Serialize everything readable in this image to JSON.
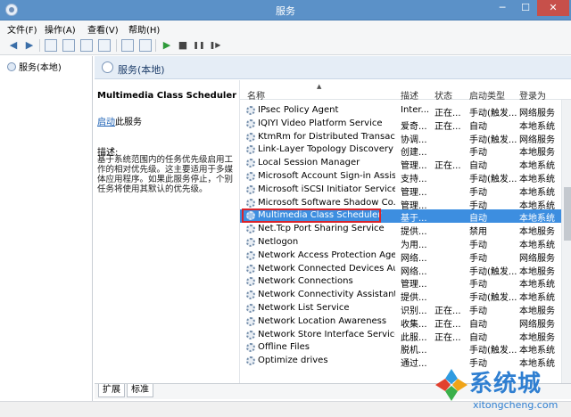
{
  "window": {
    "title": "服务",
    "minimize": "─",
    "maximize": "☐",
    "close": "✕"
  },
  "menu": [
    "文件(F)",
    "操作(A)",
    "查看(V)",
    "帮助(H)"
  ],
  "toolbar": {
    "back": "◀",
    "forward": "▶",
    "play": "▶",
    "stop": "■",
    "pause": "❚❚",
    "restart": "❚▶"
  },
  "tree": {
    "item": "服务(本地)"
  },
  "header": {
    "title": "服务(本地)"
  },
  "detail": {
    "name": "Multimedia Class Scheduler",
    "start_link": "启动",
    "start_suffix": "此服务",
    "desc_label": "描述:",
    "description": "基于系统范围内的任务优先级启用工作的相对优先级。这主要适用于多媒体应用程序。如果此服务停止，个别任务将使用其默认的优先级。"
  },
  "columns": {
    "name": "名称",
    "desc": "描述",
    "status": "状态",
    "start": "启动类型",
    "logon": "登录为"
  },
  "rows": [
    {
      "name": "IPsec Policy Agent",
      "desc": "Inter...",
      "status": "正在...",
      "start": "手动(触发...",
      "logon": "网络服务"
    },
    {
      "name": "IQIYI Video Platform Service",
      "desc": "爱奇...",
      "status": "正在...",
      "start": "自动",
      "logon": "本地系统"
    },
    {
      "name": "KtmRm for Distributed Transacti...",
      "desc": "协调...",
      "status": "",
      "start": "手动(触发...",
      "logon": "网络服务"
    },
    {
      "name": "Link-Layer Topology Discovery ...",
      "desc": "创建...",
      "status": "",
      "start": "手动",
      "logon": "本地服务"
    },
    {
      "name": "Local Session Manager",
      "desc": "管理...",
      "status": "正在...",
      "start": "自动",
      "logon": "本地系统"
    },
    {
      "name": "Microsoft Account Sign-in Assist...",
      "desc": "支持...",
      "status": "",
      "start": "手动(触发...",
      "logon": "本地系统"
    },
    {
      "name": "Microsoft iSCSI Initiator Service",
      "desc": "管理...",
      "status": "",
      "start": "手动",
      "logon": "本地系统"
    },
    {
      "name": "Microsoft Software Shadow Co...",
      "desc": "管理...",
      "status": "",
      "start": "手动",
      "logon": "本地系统"
    },
    {
      "name": "Multimedia Class Scheduler",
      "desc": "基于...",
      "status": "",
      "start": "自动",
      "logon": "本地系统"
    },
    {
      "name": "Net.Tcp Port Sharing Service",
      "desc": "提供...",
      "status": "",
      "start": "禁用",
      "logon": "本地服务"
    },
    {
      "name": "Netlogon",
      "desc": "为用...",
      "status": "",
      "start": "手动",
      "logon": "本地系统"
    },
    {
      "name": "Network Access Protection Agent",
      "desc": "网络...",
      "status": "",
      "start": "手动",
      "logon": "网络服务"
    },
    {
      "name": "Network Connected Devices Aut...",
      "desc": "网络...",
      "status": "",
      "start": "手动(触发...",
      "logon": "本地服务"
    },
    {
      "name": "Network Connections",
      "desc": "管理...",
      "status": "",
      "start": "手动",
      "logon": "本地系统"
    },
    {
      "name": "Network Connectivity Assistant",
      "desc": "提供...",
      "status": "",
      "start": "手动(触发...",
      "logon": "本地系统"
    },
    {
      "name": "Network List Service",
      "desc": "识别...",
      "status": "正在...",
      "start": "手动",
      "logon": "本地服务"
    },
    {
      "name": "Network Location Awareness",
      "desc": "收集...",
      "status": "正在...",
      "start": "自动",
      "logon": "网络服务"
    },
    {
      "name": "Network Store Interface Service",
      "desc": "此服...",
      "status": "正在...",
      "start": "自动",
      "logon": "本地服务"
    },
    {
      "name": "Offline Files",
      "desc": "脱机...",
      "status": "",
      "start": "手动(触发...",
      "logon": "本地系统"
    },
    {
      "name": "Optimize drives",
      "desc": "通过...",
      "status": "",
      "start": "手动",
      "logon": "本地系统"
    }
  ],
  "tabs": [
    "扩展",
    "标准"
  ],
  "watermark": {
    "big": "系统城",
    "small": "xitongcheng.com"
  },
  "colors": {
    "titlebar": "#5b91c8",
    "selection": "#3d8ee0",
    "highlight_outline": "#d9232a",
    "watermark": "#2f7fd1"
  }
}
